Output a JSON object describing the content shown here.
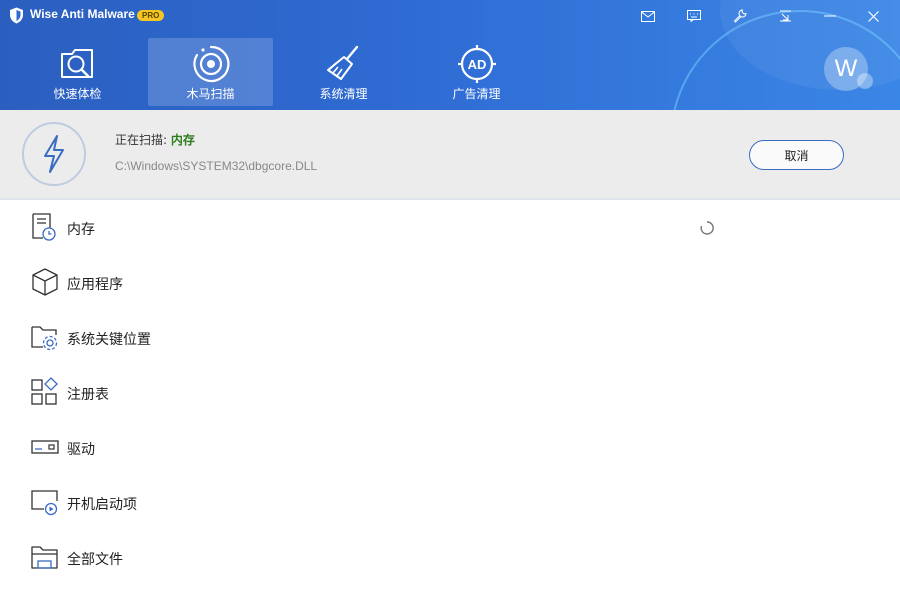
{
  "app": {
    "title": "Wise Anti Malware",
    "badge": "PRO"
  },
  "window_controls": [
    "mail-icon",
    "feedback-icon",
    "tools-icon",
    "minimize-to-tray-icon",
    "minimize-icon",
    "close-icon"
  ],
  "nav": {
    "tabs": [
      {
        "label": "快速体检",
        "icon": "quick-scan-icon",
        "active": false
      },
      {
        "label": "木马扫描",
        "icon": "trojan-scan-icon",
        "active": true
      },
      {
        "label": "系统清理",
        "icon": "system-clean-icon",
        "active": false
      },
      {
        "label": "广告清理",
        "icon": "ad-clean-icon",
        "active": false
      }
    ],
    "ad_icon_text": "AD"
  },
  "user": {
    "avatar_letter": "W"
  },
  "scan": {
    "label": "正在扫描: ",
    "target": "内存",
    "path": "C:\\Windows\\SYSTEM32\\dbgcore.DLL",
    "cancel_label": "取消"
  },
  "items": [
    {
      "label": "内存",
      "icon": "memory-icon",
      "status": "scanning"
    },
    {
      "label": "应用程序",
      "icon": "application-icon"
    },
    {
      "label": "系统关键位置",
      "icon": "system-critical-folder-icon"
    },
    {
      "label": "注册表",
      "icon": "registry-icon"
    },
    {
      "label": "驱动",
      "icon": "driver-icon"
    },
    {
      "label": "开机启动项",
      "icon": "startup-icon"
    },
    {
      "label": "全部文件",
      "icon": "all-files-icon"
    }
  ],
  "colors": {
    "header": "#2f6bd3",
    "accent_green": "#2f7d1e",
    "status_bg": "#ececec"
  }
}
